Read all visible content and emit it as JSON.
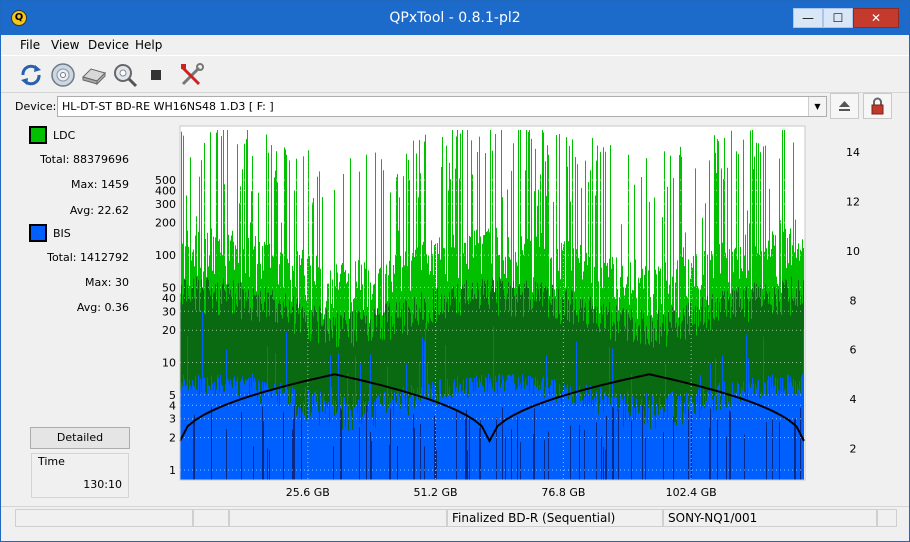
{
  "window": {
    "title": "QPxTool - 0.8.1-pl2",
    "app_icon_glyph": "Q"
  },
  "menu": {
    "file": "File",
    "view": "View",
    "device": "Device",
    "help": "Help"
  },
  "toolbar": {
    "icons": [
      "refresh-icon",
      "disc-icon",
      "drive-icon",
      "scan-icon",
      "stop-icon",
      "tools-icon"
    ]
  },
  "device": {
    "label": "Device:",
    "value": "HL-DT-ST BD-RE  WH16NS48  1.D3 [ F: ]"
  },
  "legend": {
    "ldc": {
      "label": "LDC",
      "color": "#00c000",
      "total_label": "Total:",
      "total": "88379696",
      "max_label": "Max:",
      "max": "1459",
      "avg_label": "Avg:",
      "avg": "22.62"
    },
    "bis": {
      "label": "BIS",
      "color": "#0060ff",
      "total_label": "Total:",
      "total": "1412792",
      "max_label": "Max:",
      "max": "30",
      "avg_label": "Avg:",
      "avg": "0.36"
    }
  },
  "detailed_button": "Detailed",
  "time": {
    "label": "Time",
    "value": "130:10"
  },
  "status": {
    "disc_type": "Finalized BD-R (Sequential)",
    "media_id": "SONY-NQ1/001"
  },
  "chart_data": {
    "type": "bar",
    "y_left_scale": "log",
    "y_left_ticks": [
      "1",
      "2",
      "3",
      "4",
      "5",
      "10",
      "20",
      "30",
      "40",
      "50",
      "100",
      "200",
      "300",
      "400",
      "500"
    ],
    "y_right_ticks": [
      "2",
      "4",
      "6",
      "8",
      "10",
      "12",
      "14"
    ],
    "x_ticks": [
      "25.6 GB",
      "51.2 GB",
      "76.8 GB",
      "102.4 GB"
    ],
    "x_tick_values": [
      25.6,
      51.2,
      76.8,
      102.4
    ],
    "xlim": [
      0,
      125
    ],
    "grid": true,
    "series": [
      {
        "name": "LDC",
        "color": "#00c000",
        "peak_max": 1459,
        "typical_range": [
          20,
          200
        ]
      },
      {
        "name": "BIS",
        "color": "#0060ff",
        "peak_max": 30,
        "typical_range": [
          2,
          8
        ]
      }
    ],
    "speed_curve": {
      "color": "#000000",
      "x": [
        0,
        31,
        62,
        94,
        125
      ],
      "y": [
        2.3,
        5.0,
        2.3,
        5.0,
        2.3
      ]
    }
  }
}
